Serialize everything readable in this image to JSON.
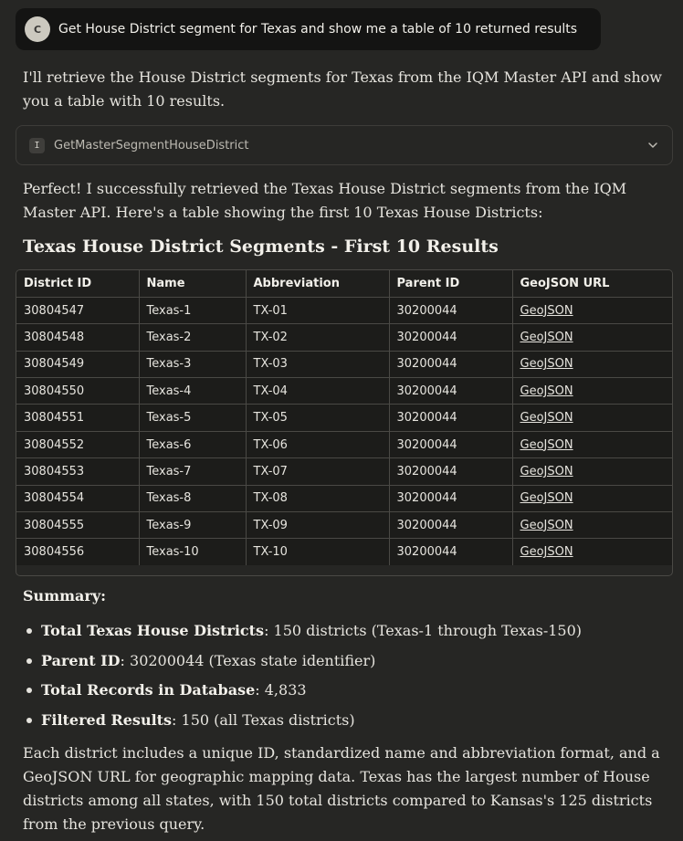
{
  "user_message": {
    "avatar_initial": "C",
    "text": "Get House District segment for Texas and show me a table of 10 returned results"
  },
  "intro": "I'll retrieve the House District segments for Texas from the IQM Master API and show you a table with 10 results.",
  "tool_call": {
    "icon_letter": "I",
    "name": "GetMasterSegmentHouseDistrict"
  },
  "result_text": "Perfect! I successfully retrieved the Texas House District segments from the IQM Master API. Here's a table showing the first 10 Texas House Districts:",
  "table": {
    "title": "Texas House District Segments - First 10 Results",
    "headers": [
      "District ID",
      "Name",
      "Abbreviation",
      "Parent ID",
      "GeoJSON URL"
    ],
    "rows": [
      [
        "30804547",
        "Texas-1",
        "TX-01",
        "30200044",
        "GeoJSON"
      ],
      [
        "30804548",
        "Texas-2",
        "TX-02",
        "30200044",
        "GeoJSON"
      ],
      [
        "30804549",
        "Texas-3",
        "TX-03",
        "30200044",
        "GeoJSON"
      ],
      [
        "30804550",
        "Texas-4",
        "TX-04",
        "30200044",
        "GeoJSON"
      ],
      [
        "30804551",
        "Texas-5",
        "TX-05",
        "30200044",
        "GeoJSON"
      ],
      [
        "30804552",
        "Texas-6",
        "TX-06",
        "30200044",
        "GeoJSON"
      ],
      [
        "30804553",
        "Texas-7",
        "TX-07",
        "30200044",
        "GeoJSON"
      ],
      [
        "30804554",
        "Texas-8",
        "TX-08",
        "30200044",
        "GeoJSON"
      ],
      [
        "30804555",
        "Texas-9",
        "TX-09",
        "30200044",
        "GeoJSON"
      ],
      [
        "30804556",
        "Texas-10",
        "TX-10",
        "30200044",
        "GeoJSON"
      ]
    ]
  },
  "summary": {
    "heading": "Summary:",
    "items": [
      {
        "label": "Total Texas House Districts",
        "value": ": 150 districts (Texas-1 through Texas-150)"
      },
      {
        "label": "Parent ID",
        "value": ": 30200044 (Texas state identifier)"
      },
      {
        "label": "Total Records in Database",
        "value": ": 4,833"
      },
      {
        "label": "Filtered Results",
        "value": ": 150 (all Texas districts)"
      }
    ]
  },
  "closing": "Each district includes a unique ID, standardized name and abbreviation format, and a GeoJSON URL for geographic mapping data. Texas has the largest number of House districts among all states, with 150 total districts compared to Kansas's 125 districts from the previous query."
}
